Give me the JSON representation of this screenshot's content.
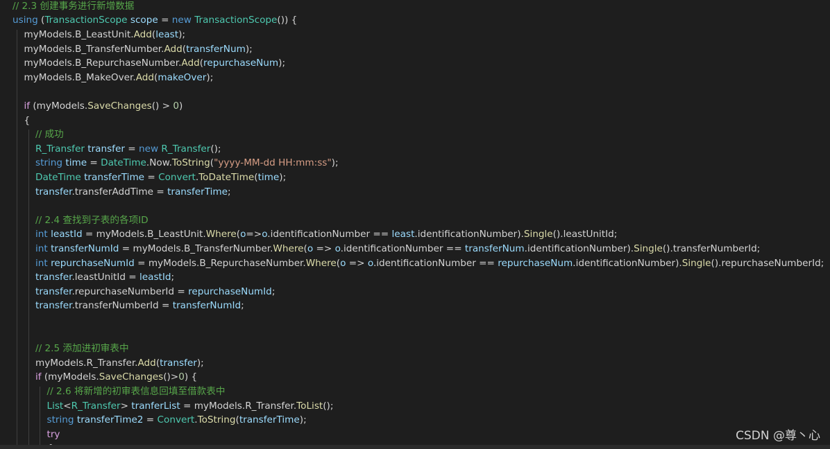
{
  "theme": {
    "background": "#1e1e1e",
    "colors": {
      "p": "#d4d4d4",
      "c": "#57a64a",
      "k": "#569cd6",
      "ctrl": "#d8a0df",
      "t": "#4ec9b0",
      "v": "#9cdcfe",
      "m": "#dcdcaa",
      "s": "#d69d85",
      "n": "#b5cea8"
    }
  },
  "watermark": "CSDN @尊丶心",
  "code_lines": [
    {
      "indent": 1,
      "tokens": [
        [
          "// 2.3 创建事务进行新增数据",
          "c"
        ]
      ]
    },
    {
      "indent": 1,
      "tokens": [
        [
          "using",
          "k"
        ],
        [
          " (",
          "p"
        ],
        [
          "TransactionScope",
          "t"
        ],
        [
          " ",
          "p"
        ],
        [
          "scope",
          "v"
        ],
        [
          " = ",
          "p"
        ],
        [
          "new",
          "k"
        ],
        [
          " ",
          "p"
        ],
        [
          "TransactionScope",
          "t"
        ],
        [
          "()) {",
          "p"
        ]
      ]
    },
    {
      "indent": 2,
      "tokens": [
        [
          "myModels.B_LeastUnit.",
          "p"
        ],
        [
          "Add",
          "m"
        ],
        [
          "(",
          "p"
        ],
        [
          "least",
          "v"
        ],
        [
          ");",
          "p"
        ]
      ]
    },
    {
      "indent": 2,
      "tokens": [
        [
          "myModels.B_TransferNumber.",
          "p"
        ],
        [
          "Add",
          "m"
        ],
        [
          "(",
          "p"
        ],
        [
          "transferNum",
          "v"
        ],
        [
          ");",
          "p"
        ]
      ]
    },
    {
      "indent": 2,
      "tokens": [
        [
          "myModels.B_RepurchaseNumber.",
          "p"
        ],
        [
          "Add",
          "m"
        ],
        [
          "(",
          "p"
        ],
        [
          "repurchaseNum",
          "v"
        ],
        [
          ");",
          "p"
        ]
      ]
    },
    {
      "indent": 2,
      "tokens": [
        [
          "myModels.B_MakeOver.",
          "p"
        ],
        [
          "Add",
          "m"
        ],
        [
          "(",
          "p"
        ],
        [
          "makeOver",
          "v"
        ],
        [
          ");",
          "p"
        ]
      ]
    },
    {
      "indent": 2,
      "tokens": []
    },
    {
      "indent": 2,
      "tokens": [
        [
          "if",
          "ctrl"
        ],
        [
          " (myModels.",
          "p"
        ],
        [
          "SaveChanges",
          "m"
        ],
        [
          "() > ",
          "p"
        ],
        [
          "0",
          "n"
        ],
        [
          ")",
          "p"
        ]
      ]
    },
    {
      "indent": 2,
      "tokens": [
        [
          "{",
          "p"
        ]
      ]
    },
    {
      "indent": 3,
      "tokens": [
        [
          "// 成功",
          "c"
        ]
      ]
    },
    {
      "indent": 3,
      "tokens": [
        [
          "R_Transfer",
          "t"
        ],
        [
          " ",
          "p"
        ],
        [
          "transfer",
          "v"
        ],
        [
          " = ",
          "p"
        ],
        [
          "new",
          "k"
        ],
        [
          " ",
          "p"
        ],
        [
          "R_Transfer",
          "t"
        ],
        [
          "();",
          "p"
        ]
      ]
    },
    {
      "indent": 3,
      "tokens": [
        [
          "string",
          "k"
        ],
        [
          " ",
          "p"
        ],
        [
          "time",
          "v"
        ],
        [
          " = ",
          "p"
        ],
        [
          "DateTime",
          "t"
        ],
        [
          ".Now.",
          "p"
        ],
        [
          "ToString",
          "m"
        ],
        [
          "(",
          "p"
        ],
        [
          "\"yyyy-MM-dd HH:mm:ss\"",
          "s"
        ],
        [
          ");",
          "p"
        ]
      ]
    },
    {
      "indent": 3,
      "tokens": [
        [
          "DateTime",
          "t"
        ],
        [
          " ",
          "p"
        ],
        [
          "transferTime",
          "v"
        ],
        [
          " = ",
          "p"
        ],
        [
          "Convert",
          "t"
        ],
        [
          ".",
          "p"
        ],
        [
          "ToDateTime",
          "m"
        ],
        [
          "(",
          "p"
        ],
        [
          "time",
          "v"
        ],
        [
          ");",
          "p"
        ]
      ]
    },
    {
      "indent": 3,
      "tokens": [
        [
          "transfer",
          "v"
        ],
        [
          ".transferAddTime = ",
          "p"
        ],
        [
          "transferTime",
          "v"
        ],
        [
          ";",
          "p"
        ]
      ]
    },
    {
      "indent": 3,
      "tokens": []
    },
    {
      "indent": 3,
      "tokens": [
        [
          "// 2.4 查找到子表的各项ID",
          "c"
        ]
      ]
    },
    {
      "indent": 3,
      "tokens": [
        [
          "int",
          "k"
        ],
        [
          " ",
          "p"
        ],
        [
          "leastId",
          "v"
        ],
        [
          " = myModels.B_LeastUnit.",
          "p"
        ],
        [
          "Where",
          "m"
        ],
        [
          "(",
          "p"
        ],
        [
          "o",
          "v"
        ],
        [
          "=>",
          "p"
        ],
        [
          "o",
          "v"
        ],
        [
          ".identificationNumber == ",
          "p"
        ],
        [
          "least",
          "v"
        ],
        [
          ".identificationNumber).",
          "p"
        ],
        [
          "Single",
          "m"
        ],
        [
          "().leastUnitId;",
          "p"
        ]
      ]
    },
    {
      "indent": 3,
      "tokens": [
        [
          "int",
          "k"
        ],
        [
          " ",
          "p"
        ],
        [
          "transferNumId",
          "v"
        ],
        [
          " = myModels.B_TransferNumber.",
          "p"
        ],
        [
          "Where",
          "m"
        ],
        [
          "(",
          "p"
        ],
        [
          "o",
          "v"
        ],
        [
          " => ",
          "p"
        ],
        [
          "o",
          "v"
        ],
        [
          ".identificationNumber == ",
          "p"
        ],
        [
          "transferNum",
          "v"
        ],
        [
          ".identificationNumber).",
          "p"
        ],
        [
          "Single",
          "m"
        ],
        [
          "().transferNumberId;",
          "p"
        ]
      ]
    },
    {
      "indent": 3,
      "tokens": [
        [
          "int",
          "k"
        ],
        [
          " ",
          "p"
        ],
        [
          "repurchaseNumId",
          "v"
        ],
        [
          " = myModels.B_RepurchaseNumber.",
          "p"
        ],
        [
          "Where",
          "m"
        ],
        [
          "(",
          "p"
        ],
        [
          "o",
          "v"
        ],
        [
          " => ",
          "p"
        ],
        [
          "o",
          "v"
        ],
        [
          ".identificationNumber == ",
          "p"
        ],
        [
          "repurchaseNum",
          "v"
        ],
        [
          ".identificationNumber).",
          "p"
        ],
        [
          "Single",
          "m"
        ],
        [
          "().repurchaseNumberId;",
          "p"
        ]
      ]
    },
    {
      "indent": 3,
      "tokens": [
        [
          "transfer",
          "v"
        ],
        [
          ".leastUnitId = ",
          "p"
        ],
        [
          "leastId",
          "v"
        ],
        [
          ";",
          "p"
        ]
      ]
    },
    {
      "indent": 3,
      "tokens": [
        [
          "transfer",
          "v"
        ],
        [
          ".repurchaseNumberId = ",
          "p"
        ],
        [
          "repurchaseNumId",
          "v"
        ],
        [
          ";",
          "p"
        ]
      ]
    },
    {
      "indent": 3,
      "tokens": [
        [
          "transfer",
          "v"
        ],
        [
          ".transferNumberId = ",
          "p"
        ],
        [
          "transferNumId",
          "v"
        ],
        [
          ";",
          "p"
        ]
      ]
    },
    {
      "indent": 3,
      "tokens": []
    },
    {
      "indent": 3,
      "tokens": []
    },
    {
      "indent": 3,
      "tokens": [
        [
          "// 2.5 添加进初审表中",
          "c"
        ]
      ]
    },
    {
      "indent": 3,
      "tokens": [
        [
          "myModels.R_Transfer.",
          "p"
        ],
        [
          "Add",
          "m"
        ],
        [
          "(",
          "p"
        ],
        [
          "transfer",
          "v"
        ],
        [
          ");",
          "p"
        ]
      ]
    },
    {
      "indent": 3,
      "tokens": [
        [
          "if",
          "ctrl"
        ],
        [
          " (myModels.",
          "p"
        ],
        [
          "SaveChanges",
          "m"
        ],
        [
          "()>",
          "p"
        ],
        [
          "0",
          "n"
        ],
        [
          ") {",
          "p"
        ]
      ]
    },
    {
      "indent": 4,
      "tokens": [
        [
          "// 2.6 将新增的初审表信息回填至借款表中",
          "c"
        ]
      ]
    },
    {
      "indent": 4,
      "tokens": [
        [
          "List",
          "t"
        ],
        [
          "<",
          "p"
        ],
        [
          "R_Transfer",
          "t"
        ],
        [
          "> ",
          "p"
        ],
        [
          "tranferList",
          "v"
        ],
        [
          " = myModels.R_Transfer.",
          "p"
        ],
        [
          "ToList",
          "m"
        ],
        [
          "();",
          "p"
        ]
      ]
    },
    {
      "indent": 4,
      "tokens": [
        [
          "string",
          "k"
        ],
        [
          " ",
          "p"
        ],
        [
          "transferTime2",
          "v"
        ],
        [
          " = ",
          "p"
        ],
        [
          "Convert",
          "t"
        ],
        [
          ".",
          "p"
        ],
        [
          "ToString",
          "m"
        ],
        [
          "(",
          "p"
        ],
        [
          "transferTime",
          "v"
        ],
        [
          ");",
          "p"
        ]
      ]
    },
    {
      "indent": 4,
      "tokens": [
        [
          "try",
          "ctrl"
        ]
      ]
    },
    {
      "indent": 4,
      "tokens": [
        [
          "{",
          "p"
        ]
      ]
    }
  ]
}
